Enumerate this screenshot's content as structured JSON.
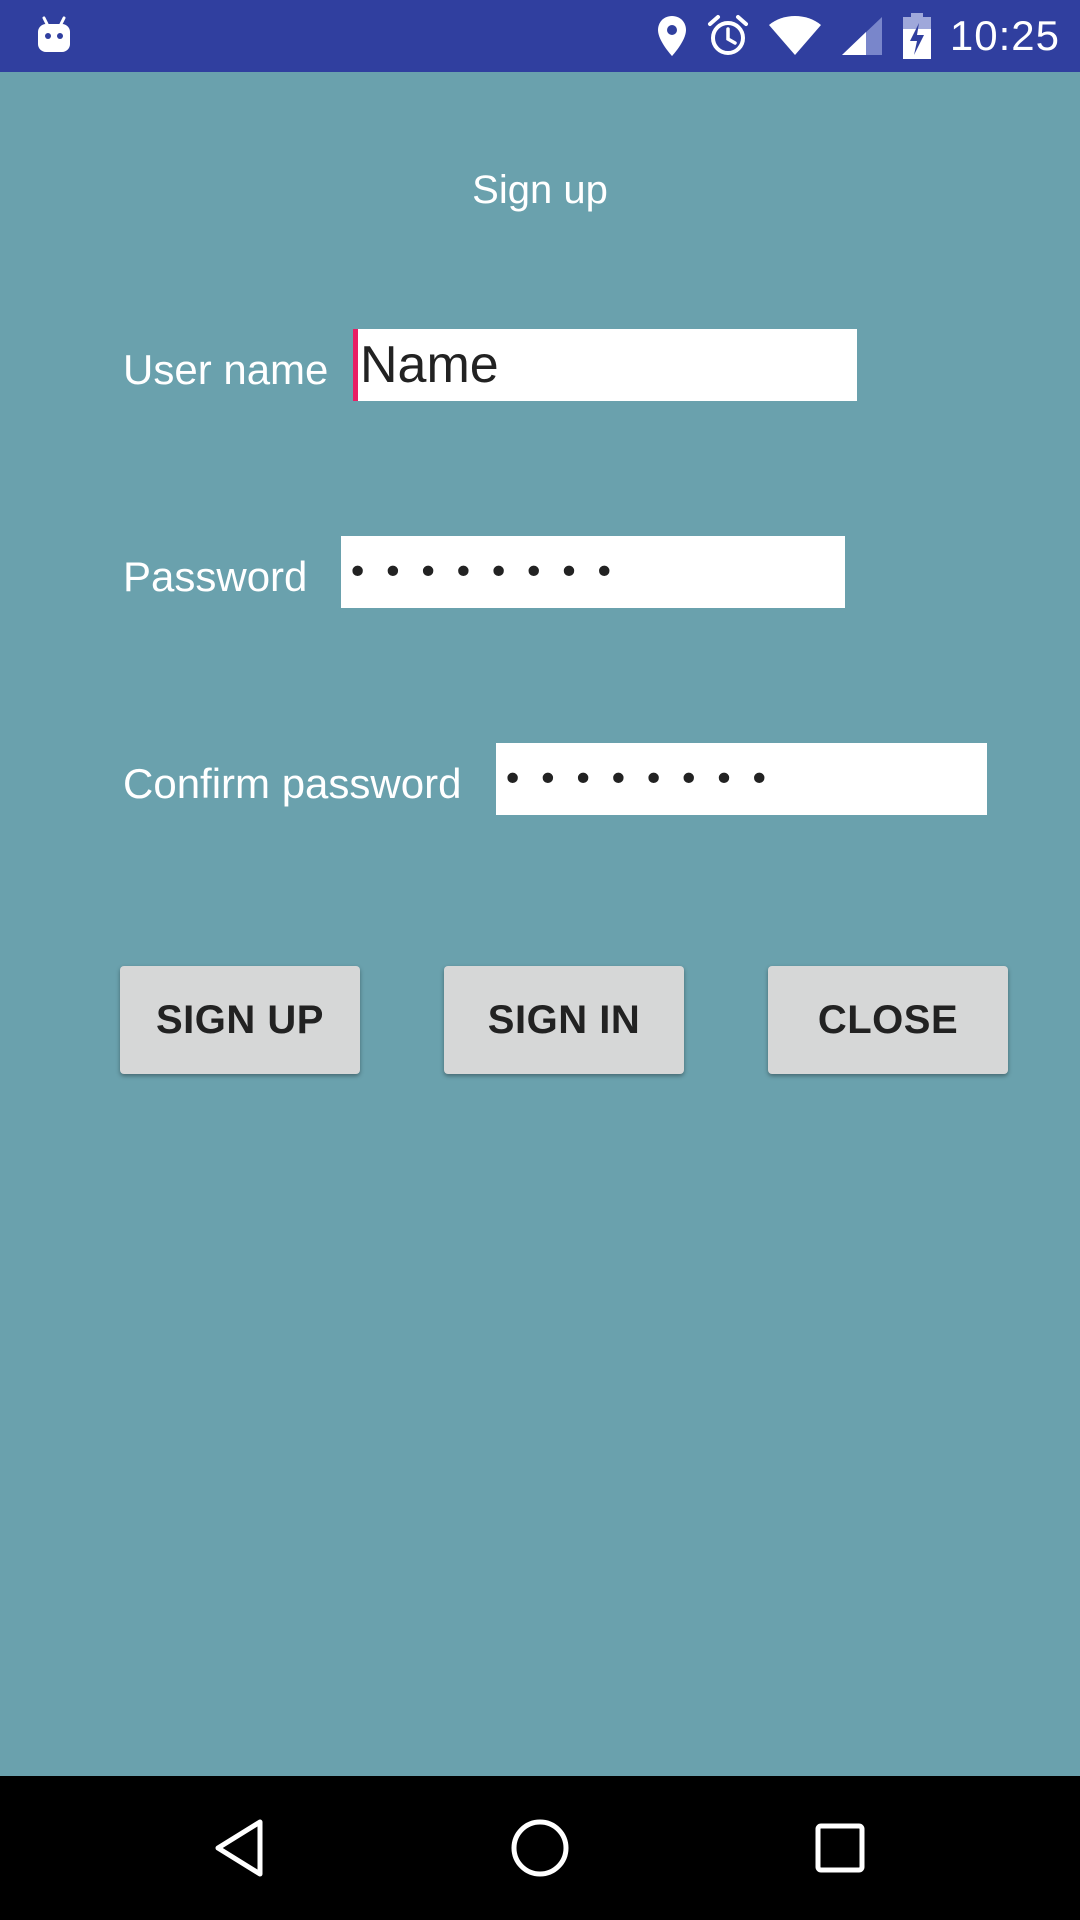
{
  "status_bar": {
    "time": "10:25",
    "icons": [
      "android-icon",
      "location-icon",
      "alarm-icon",
      "wifi-icon",
      "cell-signal-icon",
      "battery-charging-icon"
    ]
  },
  "form": {
    "title": "Sign up",
    "username": {
      "label": "User name",
      "value": "Name"
    },
    "password": {
      "label": "Password",
      "value": "••••••••"
    },
    "confirm_password": {
      "label": "Confirm password",
      "value": "••••••••"
    }
  },
  "buttons": {
    "sign_up": "SIGN UP",
    "sign_in": "SIGN IN",
    "close": "CLOSE"
  },
  "colors": {
    "status_bar": "#303f9f",
    "background": "#6aa1ad",
    "button": "#d6d7d7",
    "focus_accent": "#e91e63"
  },
  "nav_bar": {
    "icons": [
      "back-icon",
      "home-icon",
      "recents-icon"
    ]
  }
}
